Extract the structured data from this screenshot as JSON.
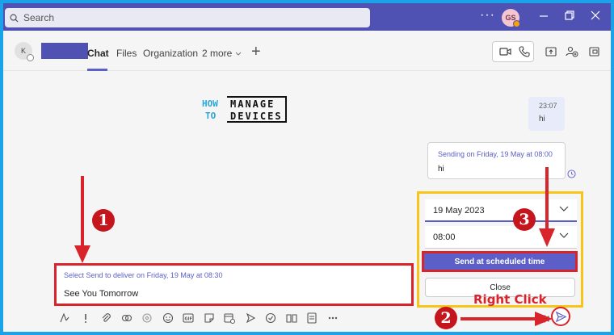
{
  "search": {
    "placeholder": "Search"
  },
  "user": {
    "initials": "GS"
  },
  "chat": {
    "avatar_initial": "K",
    "tabs": [
      {
        "label": "Chat",
        "active": true
      },
      {
        "label": "Files"
      },
      {
        "label": "Organization"
      },
      {
        "label": "2 more"
      }
    ]
  },
  "logo": {
    "how": "HOW",
    "to": "TO",
    "manage": "MANAGE",
    "devices": "DEVICES"
  },
  "messages": {
    "sent": {
      "time": "23:07",
      "text": "hi"
    },
    "scheduled": {
      "status": "Sending on Friday, 19 May at 08:00",
      "text": "hi"
    }
  },
  "schedule": {
    "date": "19 May 2023",
    "time": "08:00",
    "send_label": "Send at scheduled time",
    "close_label": "Close"
  },
  "compose": {
    "hint": "Select Send to deliver on Friday, 19 May at 08:30",
    "text": "See You Tomorrow"
  },
  "annotations": {
    "step1": "1",
    "step2": "2",
    "step3": "3",
    "right_click": "Right Click"
  },
  "colors": {
    "brand": "#4f52b2",
    "accent": "#5b5fc7",
    "annotation_red": "#d9242b",
    "highlight_yellow": "#f7c519",
    "border_blue": "#1aa3e8"
  }
}
